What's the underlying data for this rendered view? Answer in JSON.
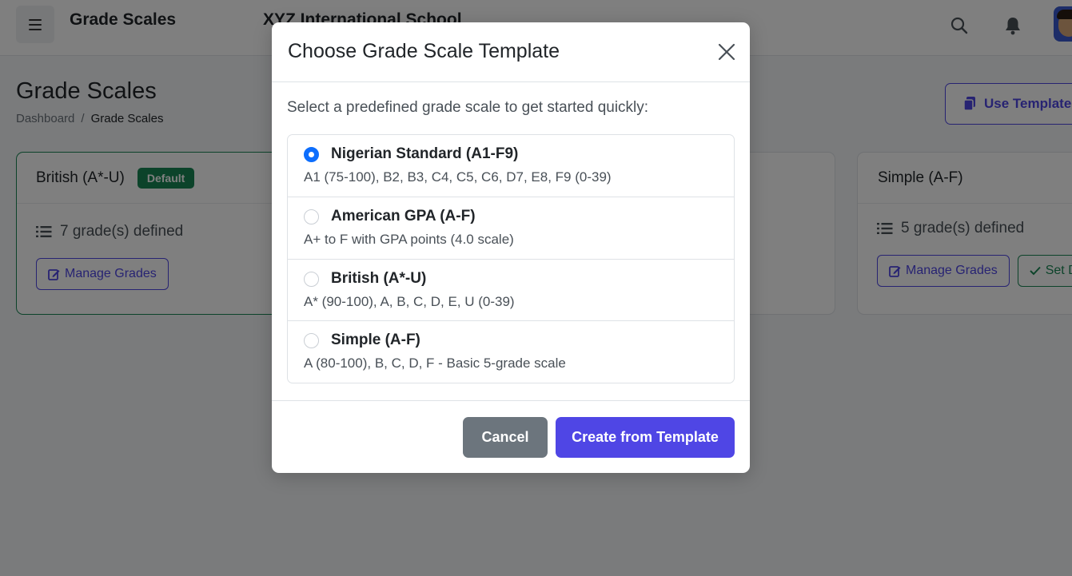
{
  "topbar": {
    "app_title": "Grade Scales",
    "school_name": "XYZ International School"
  },
  "page": {
    "title": "Grade Scales",
    "breadcrumb": {
      "home": "Dashboard",
      "separator": "/",
      "current": "Grade Scales"
    },
    "use_template_label": "Use Template"
  },
  "cards": [
    {
      "name": "British (A*-U)",
      "badge": "Default",
      "grade_count": "7 grade(s) defined",
      "manage_label": "Manage Grades"
    },
    {
      "name": "Simple (A-F)",
      "grade_count": "5 grade(s) defined",
      "manage_label": "Manage Grades",
      "set_label": "Set Default"
    }
  ],
  "modal": {
    "title": "Choose Grade Scale Template",
    "intro": "Select a predefined grade scale to get started quickly:",
    "options": [
      {
        "name": "Nigerian Standard (A1-F9)",
        "desc": "A1 (75-100), B2, B3, C4, C5, C6, D7, E8, F9 (0-39)",
        "selected": true
      },
      {
        "name": "American GPA (A-F)",
        "desc": "A+ to F with GPA points (4.0 scale)",
        "selected": false
      },
      {
        "name": "British (A*-U)",
        "desc": "A* (90-100), A, B, C, D, E, U (0-39)",
        "selected": false
      },
      {
        "name": "Simple (A-F)",
        "desc": "A (80-100), B, C, D, F - Basic 5-grade scale",
        "selected": false
      }
    ],
    "cancel_label": "Cancel",
    "create_label": "Create from Template"
  },
  "colors": {
    "primary": "#4f46e5",
    "success": "#198754",
    "radio_selected": "#0d6efd",
    "secondary": "#6c757d"
  },
  "icons": [
    "menu-icon",
    "search-icon",
    "bell-icon",
    "copy-icon",
    "list-icon",
    "edit-icon",
    "check-icon",
    "close-icon"
  ]
}
